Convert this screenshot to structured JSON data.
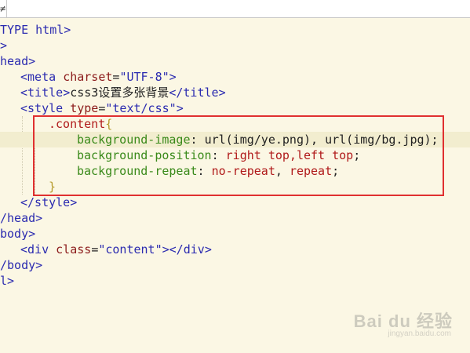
{
  "tab": {
    "label": "≠"
  },
  "code": {
    "l1": {
      "a": "TYPE html",
      "b": ">"
    },
    "l2": {
      "a": ">"
    },
    "l3": {
      "a": "head>"
    },
    "l4": {
      "open": "<",
      "tag": "meta",
      "sp": " ",
      "attr": "charset",
      "eq": "=",
      "val": "\"UTF-8\"",
      "close": ">"
    },
    "l5": {
      "open": "<",
      "tag": "title",
      "gt": ">",
      "text": "css3设置多张背景",
      "endopen": "</",
      "endtag": "title",
      "endgt": ">"
    },
    "l6": {
      "open": "<",
      "tag": "style",
      "sp": " ",
      "attr": "type",
      "eq": "=",
      "val": "\"text/css\"",
      "close": ">"
    },
    "l7": {
      "sel": ".content",
      "brace": "{"
    },
    "l8": {
      "prop": "background-image",
      "colon": ": ",
      "val": "url(img/ye.png), url(img/bg.jpg)",
      "semi": ";"
    },
    "l9": {
      "prop": "background-position",
      "colon": ": ",
      "val": "right top,left top",
      "semi": ";"
    },
    "l10": {
      "prop": "background-repeat",
      "colon": ": ",
      "kw1": "no-repeat",
      "comma": ", ",
      "kw2": "repeat",
      "semi": ";"
    },
    "l11": {
      "brace": "}"
    },
    "l12": {
      "a": "</style>"
    },
    "l13": {
      "a": "/head>"
    },
    "l14": {
      "a": "body>"
    },
    "l15": {
      "open": "<",
      "tag": "div",
      "sp": " ",
      "attr": "class",
      "eq": "=",
      "val": "\"content\"",
      "close": "></",
      "endtag": "div",
      "endgt": ">"
    },
    "l16": {
      "a": "/body>"
    },
    "l17": {
      "a": "l>"
    }
  },
  "colors": {
    "highlight_box": "#e03030",
    "current_line": "#f2edcf"
  },
  "watermark": {
    "main": "Bai du 经验",
    "sub": "jingyan.baidu.com"
  }
}
